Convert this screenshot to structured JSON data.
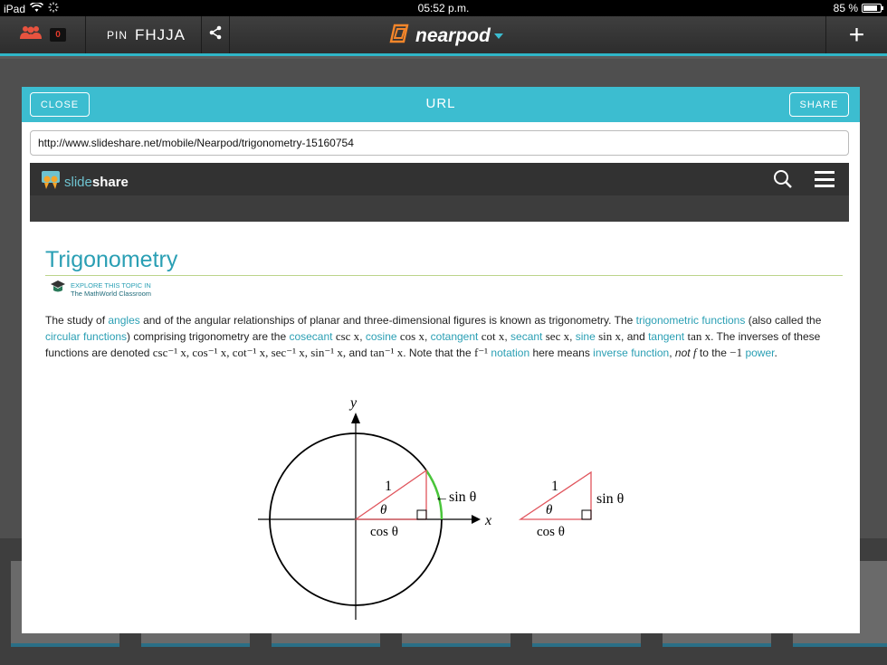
{
  "status_bar": {
    "device": "iPad",
    "time": "05:52 p.m.",
    "battery": "85 %",
    "battery_level": 0.85
  },
  "top_bar": {
    "participant_count": "0",
    "pin_label": "PIN",
    "pin_code": "FHJJA",
    "logo_text": "nearpod",
    "plus_label": "+"
  },
  "modal": {
    "close_label": "CLOSE",
    "title": "URL",
    "share_label": "SHARE",
    "url_value": "http://www.slideshare.net/mobile/Nearpod/trigonometry-15160754"
  },
  "slideshare": {
    "logo_light": "slide",
    "logo_bold": "share"
  },
  "article": {
    "title": "Trigonometry",
    "explore_line1": "EXPLORE THIS TOPIC IN",
    "explore_line2": "The MathWorld Classroom",
    "body": {
      "p1": "The study of ",
      "l_angles": "angles",
      "p2": " and of the angular relationships of planar and three-dimensional figures is known as trigonometry. The ",
      "l_trig_functions": "trigonometric functions",
      "p3": " (also called the ",
      "l_circular": "circular functions",
      "p4": ") comprising trigonometry are the ",
      "l_cosecant": "cosecant",
      "m_csc": "csc x",
      "p5": ", ",
      "l_cosine": "cosine",
      "m_cos": "cos x",
      "p6": ", ",
      "l_cotangent": "cotangent",
      "m_cot": "cot x",
      "p7": ", ",
      "l_secant": "secant",
      "m_sec": "sec x",
      "p8": ", ",
      "l_sine": "sine",
      "m_sin": "sin x",
      "p9": ", and ",
      "l_tangent": "tangent",
      "m_tan": "tan x",
      "p10": ". The inverses of these functions are denoted ",
      "m_inverses": "csc⁻¹ x, cos⁻¹ x, cot⁻¹ x, sec⁻¹ x, sin⁻¹ x,",
      "p11": " and ",
      "m_tan_inv": "tan⁻¹ x",
      "p12": ". Note that the ",
      "m_f_inv": "f⁻¹",
      "p13": " ",
      "l_notation": "notation",
      "p14": " here means ",
      "l_inverse_function": "inverse function",
      "p15": ", ",
      "p15_italic": "not",
      "p16": " ",
      "m_f": "f",
      "p17": " to the ",
      "m_minus1": "−1",
      "p18": " ",
      "l_power": "power",
      "p19": "."
    },
    "figure": {
      "y_label": "y",
      "x_label": "x",
      "hyp_label": "1",
      "angle_label": "θ",
      "cos_label": "cos θ",
      "sin_label": "sin θ",
      "sin_arrow_label": "←sin θ",
      "tri_hyp_label": "1",
      "tri_angle_label": "θ",
      "tri_sin_label": "sin θ",
      "tri_cos_label": "cos θ"
    }
  },
  "colors": {
    "accent": "#3cbdd0",
    "link": "#2a9fb4",
    "triangle": "#e0545c",
    "arc": "#49c53a",
    "logo_orange": "#f5862a",
    "badge": "#e03a2b"
  }
}
